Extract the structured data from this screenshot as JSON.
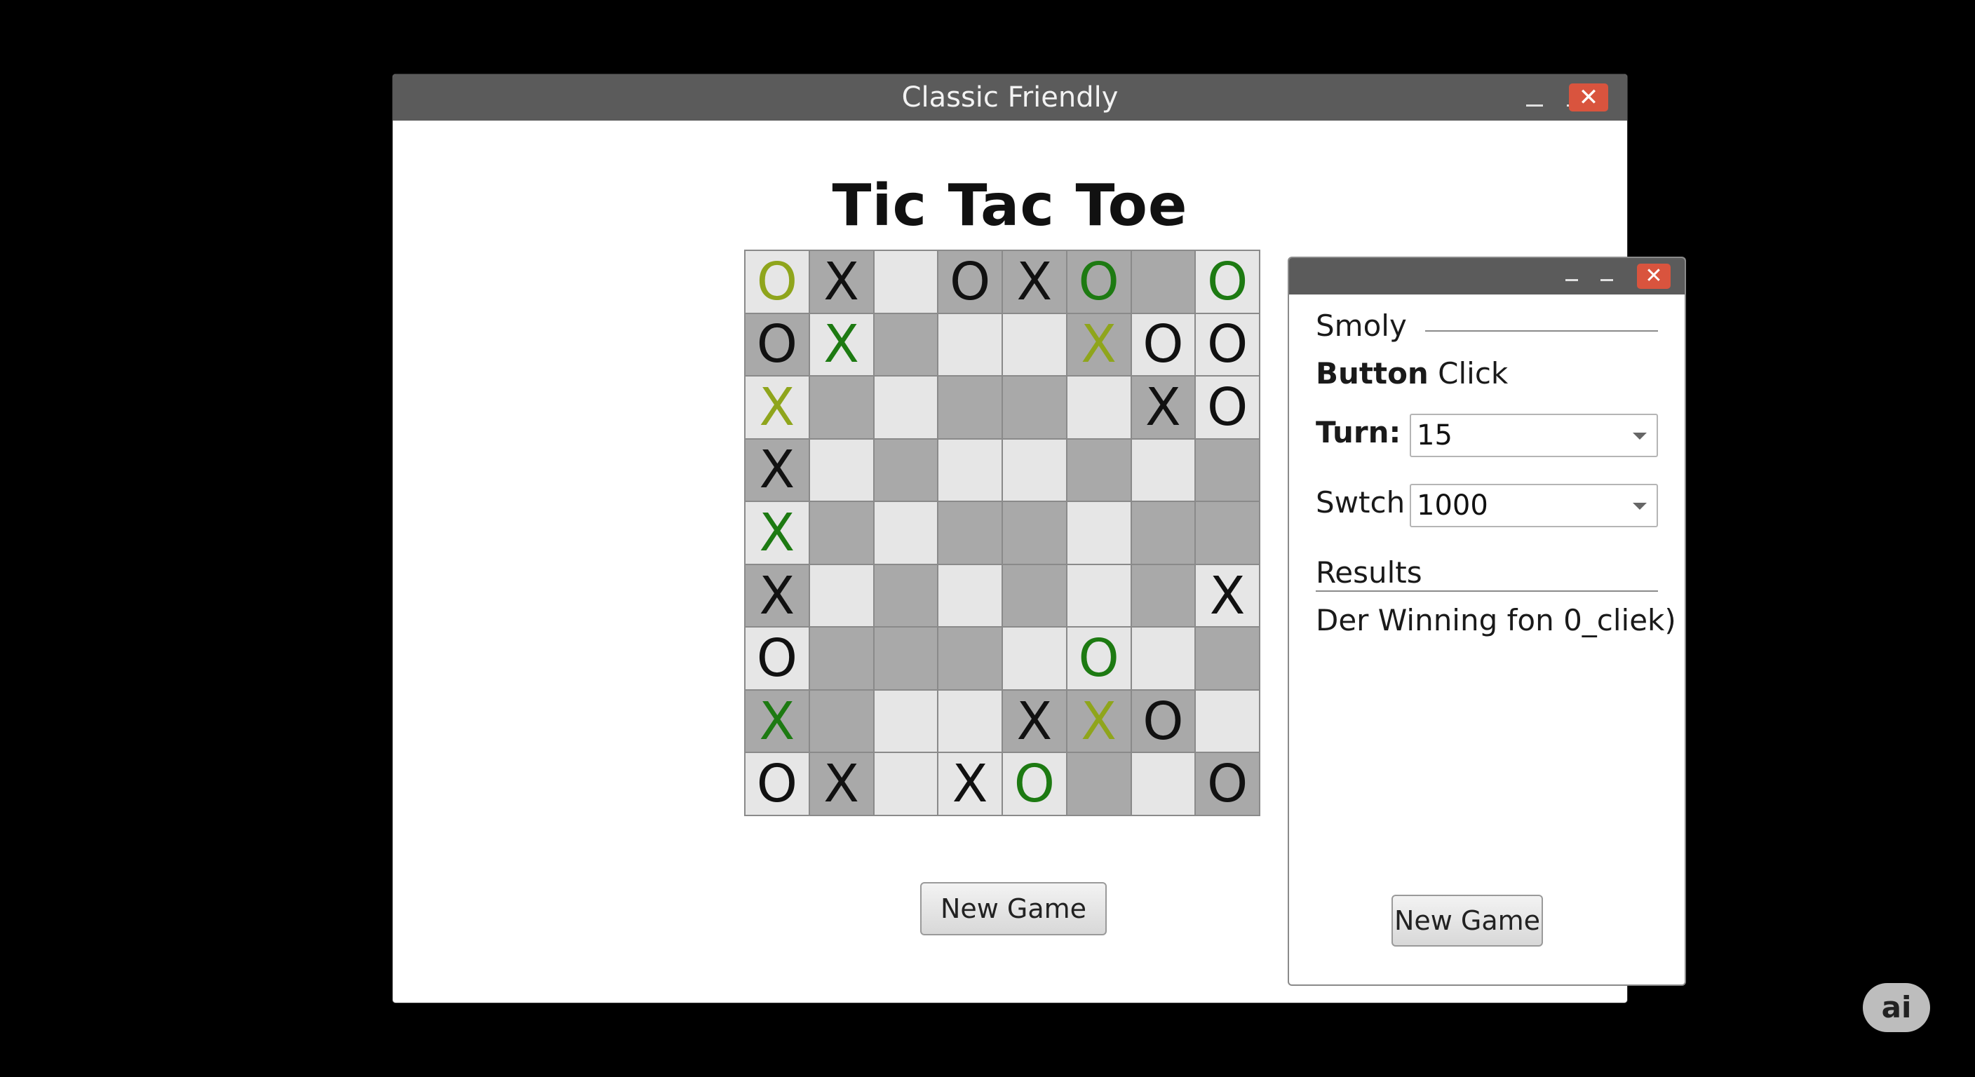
{
  "main_window": {
    "title": "Classic Friendly",
    "min_label_1": "–",
    "min_label_2": "–",
    "close_label": "✕",
    "heading": "Tic Tac Toe",
    "new_game_label": "New Game"
  },
  "board": {
    "columns": 8,
    "rows": [
      [
        {
          "mark": "O",
          "color": "lime",
          "shade": "light"
        },
        {
          "mark": "X",
          "color": "black",
          "shade": "dark"
        },
        {
          "mark": "",
          "color": "black",
          "shade": "light"
        },
        {
          "mark": "O",
          "color": "black",
          "shade": "dark"
        },
        {
          "mark": "X",
          "color": "black",
          "shade": "dark"
        },
        {
          "mark": "O",
          "color": "green",
          "shade": "dark"
        },
        {
          "mark": "",
          "color": "black",
          "shade": "dark"
        },
        {
          "mark": "O",
          "color": "green",
          "shade": "light"
        }
      ],
      [
        {
          "mark": "O",
          "color": "black",
          "shade": "dark"
        },
        {
          "mark": "X",
          "color": "green",
          "shade": "light"
        },
        {
          "mark": "",
          "color": "black",
          "shade": "dark"
        },
        {
          "mark": "",
          "color": "black",
          "shade": "light"
        },
        {
          "mark": "",
          "color": "black",
          "shade": "light"
        },
        {
          "mark": "X",
          "color": "lime",
          "shade": "dark"
        },
        {
          "mark": "O",
          "color": "black",
          "shade": "light"
        },
        {
          "mark": "O",
          "color": "black",
          "shade": "light"
        }
      ],
      [
        {
          "mark": "X",
          "color": "lime",
          "shade": "light"
        },
        {
          "mark": "",
          "color": "black",
          "shade": "dark"
        },
        {
          "mark": "",
          "color": "black",
          "shade": "light"
        },
        {
          "mark": "",
          "color": "black",
          "shade": "dark"
        },
        {
          "mark": "",
          "color": "black",
          "shade": "dark"
        },
        {
          "mark": "",
          "color": "black",
          "shade": "light"
        },
        {
          "mark": "X",
          "color": "black",
          "shade": "dark"
        },
        {
          "mark": "O",
          "color": "black",
          "shade": "light"
        }
      ],
      [
        {
          "mark": "X",
          "color": "black",
          "shade": "dark"
        },
        {
          "mark": "",
          "color": "black",
          "shade": "light"
        },
        {
          "mark": "",
          "color": "black",
          "shade": "dark"
        },
        {
          "mark": "",
          "color": "black",
          "shade": "light"
        },
        {
          "mark": "",
          "color": "black",
          "shade": "light"
        },
        {
          "mark": "",
          "color": "black",
          "shade": "dark"
        },
        {
          "mark": "",
          "color": "black",
          "shade": "light"
        },
        {
          "mark": "",
          "color": "black",
          "shade": "dark"
        }
      ],
      [
        {
          "mark": "X",
          "color": "green",
          "shade": "light"
        },
        {
          "mark": "",
          "color": "black",
          "shade": "dark"
        },
        {
          "mark": "",
          "color": "black",
          "shade": "light"
        },
        {
          "mark": "",
          "color": "black",
          "shade": "dark"
        },
        {
          "mark": "",
          "color": "black",
          "shade": "dark"
        },
        {
          "mark": "",
          "color": "black",
          "shade": "light"
        },
        {
          "mark": "",
          "color": "black",
          "shade": "dark"
        },
        {
          "mark": "",
          "color": "black",
          "shade": "dark"
        }
      ],
      [
        {
          "mark": "X",
          "color": "black",
          "shade": "dark"
        },
        {
          "mark": "",
          "color": "black",
          "shade": "light"
        },
        {
          "mark": "",
          "color": "black",
          "shade": "dark"
        },
        {
          "mark": "",
          "color": "black",
          "shade": "light"
        },
        {
          "mark": "",
          "color": "black",
          "shade": "dark"
        },
        {
          "mark": "",
          "color": "black",
          "shade": "light"
        },
        {
          "mark": "",
          "color": "black",
          "shade": "dark"
        },
        {
          "mark": "X",
          "color": "black",
          "shade": "light"
        }
      ],
      [
        {
          "mark": "O",
          "color": "black",
          "shade": "light"
        },
        {
          "mark": "",
          "color": "black",
          "shade": "dark"
        },
        {
          "mark": "",
          "color": "black",
          "shade": "dark"
        },
        {
          "mark": "",
          "color": "black",
          "shade": "dark"
        },
        {
          "mark": "",
          "color": "black",
          "shade": "light"
        },
        {
          "mark": "O",
          "color": "green",
          "shade": "light"
        },
        {
          "mark": "",
          "color": "black",
          "shade": "light"
        },
        {
          "mark": "",
          "color": "black",
          "shade": "dark"
        }
      ],
      [
        {
          "mark": "X",
          "color": "green",
          "shade": "dark"
        },
        {
          "mark": "",
          "color": "black",
          "shade": "dark"
        },
        {
          "mark": "",
          "color": "black",
          "shade": "light"
        },
        {
          "mark": "",
          "color": "black",
          "shade": "light"
        },
        {
          "mark": "X",
          "color": "black",
          "shade": "dark"
        },
        {
          "mark": "X",
          "color": "lime",
          "shade": "dark"
        },
        {
          "mark": "O",
          "color": "black",
          "shade": "dark"
        },
        {
          "mark": "",
          "color": "black",
          "shade": "light"
        }
      ],
      [
        {
          "mark": "O",
          "color": "black",
          "shade": "light"
        },
        {
          "mark": "X",
          "color": "black",
          "shade": "dark"
        },
        {
          "mark": "",
          "color": "black",
          "shade": "light"
        },
        {
          "mark": "X",
          "color": "black",
          "shade": "light"
        },
        {
          "mark": "O",
          "color": "green",
          "shade": "light"
        },
        {
          "mark": "",
          "color": "black",
          "shade": "dark"
        },
        {
          "mark": "",
          "color": "black",
          "shade": "light"
        },
        {
          "mark": "O",
          "color": "black",
          "shade": "dark"
        }
      ]
    ]
  },
  "side_window": {
    "min_label_1": "–",
    "min_label_2": "–",
    "close_label": "✕",
    "group_title": "Smoly",
    "section_label_bold": "Button",
    "section_label_rest": " Click",
    "turn_label": "Turn:",
    "turn_value": "15",
    "switch_label": "Swtch",
    "switch_value": "1000",
    "results_label": "Results",
    "results_text": "Der Winning fon 0_cliek)",
    "new_game_label": "New Game"
  },
  "badge": "ai",
  "colors": {
    "titlebar": "#5b5b5b",
    "close": "#d9543e",
    "mark_green": "#1d7a12",
    "mark_lime": "#8fa51c",
    "cell_light": "#e6e6e6",
    "cell_dark": "#a9a9a9"
  }
}
